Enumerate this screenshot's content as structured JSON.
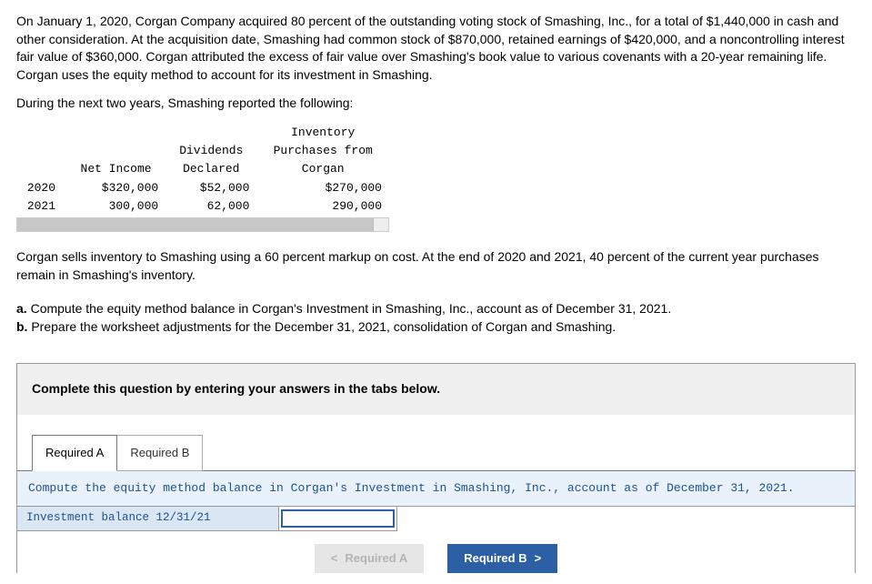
{
  "intro": {
    "p1": "On January 1, 2020, Corgan Company acquired 80 percent of the outstanding voting stock of Smashing, Inc., for a total of $1,440,000 in cash and other consideration. At the acquisition date, Smashing had common stock of $870,000, retained earnings of $420,000, and a noncontrolling interest fair value of $360,000. Corgan attributed the excess of fair value over Smashing's book value to various covenants with a 20-year remaining life. Corgan uses the equity method to account for its investment in Smashing.",
    "p2": "During the next two years, Smashing reported the following:"
  },
  "table": {
    "headers": {
      "col1_l1": "",
      "col1_l2": "",
      "col2_l1": "",
      "col2_l2": "Net Income",
      "col3_l1": "Dividends",
      "col3_l2": "Declared",
      "col4_l1": "Inventory",
      "col4_l2": "Purchases from",
      "col4_l3": "Corgan"
    },
    "rows": [
      {
        "year": "2020",
        "ni": "$320,000",
        "div": "$52,000",
        "inv": "$270,000"
      },
      {
        "year": "2021",
        "ni": "300,000",
        "div": "62,000",
        "inv": "290,000"
      }
    ]
  },
  "middle": {
    "p3": "Corgan sells inventory to Smashing using a 60 percent markup on cost. At the end of 2020 and 2021, 40 percent of the current year purchases remain in Smashing's inventory."
  },
  "questions": {
    "a_prefix": "a.",
    "a_text": " Compute the equity method balance in Corgan's Investment in Smashing, Inc., account as of December 31, 2021.",
    "b_prefix": "b.",
    "b_text": " Prepare the worksheet adjustments for the December 31, 2021, consolidation of Corgan and Smashing."
  },
  "answer": {
    "instruction": "Complete this question by entering your answers in the tabs below.",
    "tabs": {
      "a": "Required A",
      "b": "Required B"
    },
    "tabA": {
      "prompt": "Compute the equity method balance in Corgan's Investment in Smashing, Inc., account as of December 31, 2021.",
      "row_label": "Investment balance 12/31/21",
      "input_value": ""
    },
    "nav": {
      "prev": "Required A",
      "next": "Required B",
      "prev_chev": "<",
      "next_chev": ">"
    }
  }
}
